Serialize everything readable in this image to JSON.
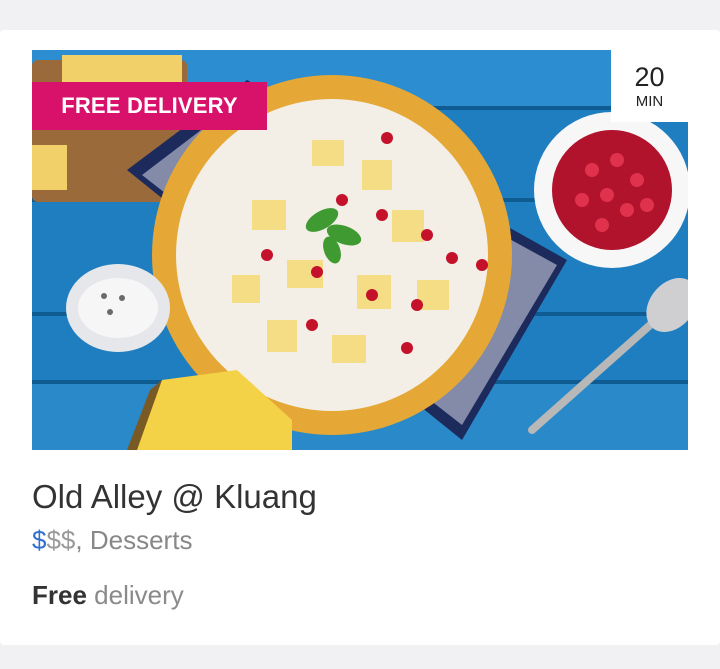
{
  "badge": {
    "label": "FREE DELIVERY"
  },
  "eta": {
    "value": "20",
    "unit": "MIN"
  },
  "restaurant": {
    "name": "Old Alley @ Kluang",
    "price_active": "$",
    "price_inactive": "$$",
    "cuisine_separator": ",",
    "cuisine": "Desserts"
  },
  "delivery": {
    "strong": "Free",
    "rest": "delivery"
  },
  "colors": {
    "badge": "#d8126a",
    "price_active": "#2f6fd1",
    "price_inactive": "#9a9a9a"
  }
}
